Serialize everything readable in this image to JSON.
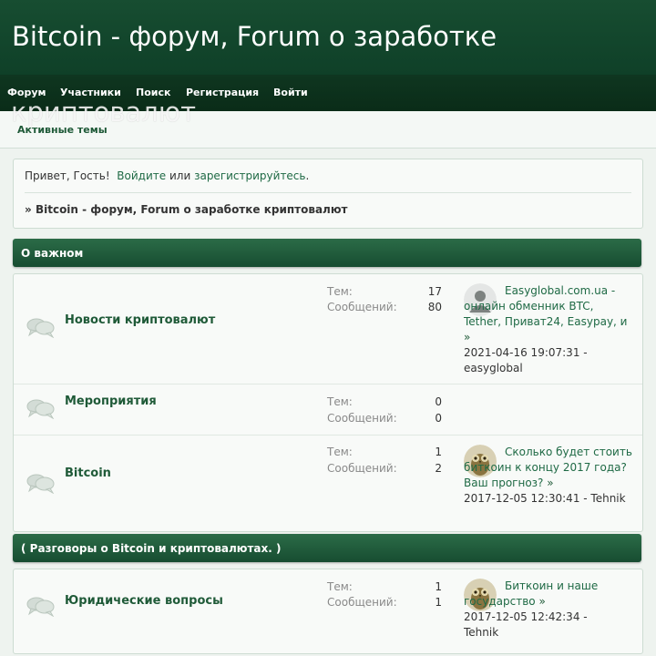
{
  "header": {
    "title": "Bitcoin - форум, Forum о заработке",
    "title_overflow": "криптовалют"
  },
  "nav": {
    "items": [
      "Форум",
      "Участники",
      "Поиск",
      "Регистрация",
      "Войти"
    ]
  },
  "subbar": {
    "active_topics": "Активные темы"
  },
  "greeting": {
    "hello": "Привет, Гость!",
    "login": "Войдите",
    "or": "или",
    "register": "зарегистрируйтесь",
    "dot": ".",
    "crumb_prefix": "»",
    "crumb": "Bitcoin - форум, Forum о заработке криптовалют"
  },
  "labels": {
    "topics": "Тем:",
    "posts": "Сообщений:",
    "arrow": "»",
    "sep": " - "
  },
  "categories": [
    {
      "title": "О важном",
      "boards": [
        {
          "name": "Новости криптовалют",
          "topics": "17",
          "posts": "80",
          "last_title": "Easyglobal.com.ua - онлайн обменник BTC, Tether, Приват24, Easypay, и",
          "last_date": "2021-04-16 19:07:31",
          "last_author": "easyglobal"
        },
        {
          "name": "Мероприятия",
          "topics": "0",
          "posts": "0"
        },
        {
          "name": "Bitcoin",
          "topics": "1",
          "posts": "2",
          "last_title": "Сколько будет стоить биткоин к концу 2017 года? Ваш прогноз?",
          "last_date": "2017-12-05 12:30:41",
          "last_author": "Tehnik"
        }
      ]
    },
    {
      "title": "( Разговоры о Bitcoin и криптовалютах. )",
      "boards": [
        {
          "name": "Юридические вопросы",
          "topics": "1",
          "posts": "1",
          "last_title": "Биткоин и наше государство",
          "last_date": "2017-12-05 12:42:34",
          "last_author": "Tehnik"
        }
      ]
    }
  ],
  "colors": {
    "header": "#174d31",
    "nav": "#0f3620",
    "link": "#1f6a45",
    "category": "#2b6b47"
  }
}
